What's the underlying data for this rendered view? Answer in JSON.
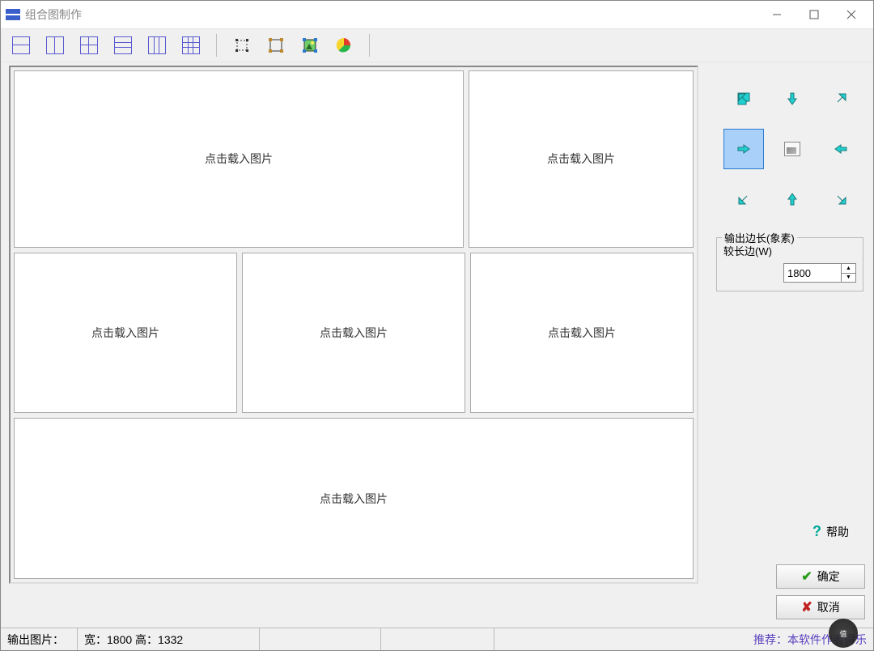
{
  "titlebar": {
    "title": "组合图制作"
  },
  "canvas": {
    "placeholder": "点击载入图片"
  },
  "output_group": {
    "label": "输出边长(象素)",
    "long_side_label": "较长边(W)",
    "value": "1800"
  },
  "help": {
    "label": "帮助"
  },
  "buttons": {
    "ok": "确定",
    "cancel": "取消"
  },
  "status": {
    "output_label": "输出图片：",
    "dims": "宽：1800 高：1332",
    "link": "推荐：本软件作者得乐"
  }
}
